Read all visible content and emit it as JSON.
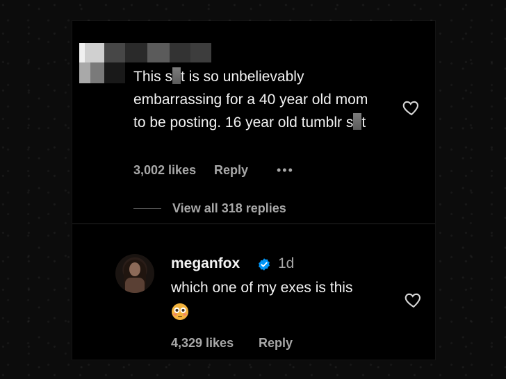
{
  "comment": {
    "text_parts": [
      "This s",
      "t is so unbelievably embarrassing for a 40 year old mom to be posting. 16 year old tumblr s",
      "t"
    ],
    "likes": "3,002 likes",
    "reply_label": "Reply",
    "more_label": "•••"
  },
  "thread": {
    "view_all_label": "View all 318 replies"
  },
  "reply": {
    "username": "meganfox",
    "time": "1d",
    "text": "which one of my exes is this",
    "likes": "4,329 likes",
    "reply_label": "Reply"
  },
  "icons": {
    "heart": "heart-outline-icon",
    "verified": "verified-badge-icon",
    "emoji": "flushed-face-emoji"
  },
  "colors": {
    "background": "#000000",
    "text": "#f2f2f2",
    "secondary_text": "#a8a8a8",
    "verified_blue": "#0095f6"
  }
}
